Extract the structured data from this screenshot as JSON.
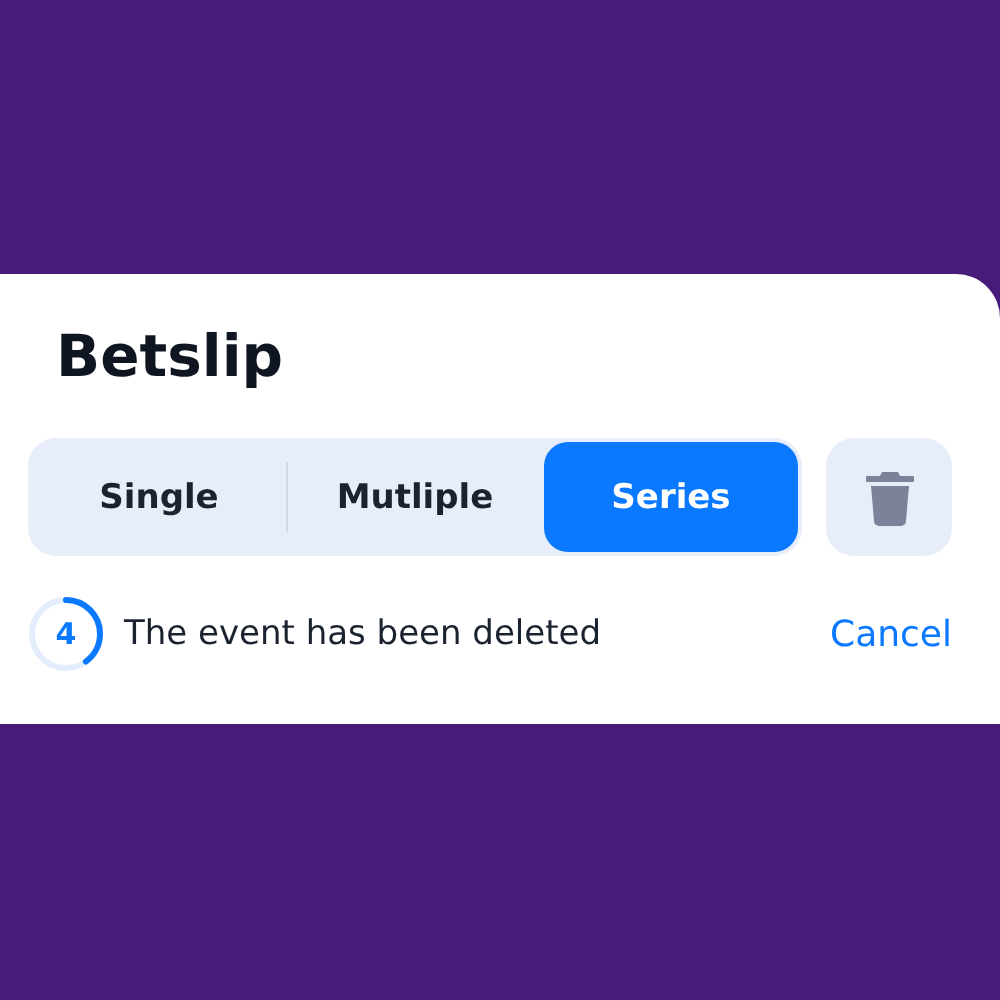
{
  "title": "Betslip",
  "tabs": [
    {
      "label": "Single",
      "selected": false
    },
    {
      "label": "Mutliple",
      "selected": false
    },
    {
      "label": "Series",
      "selected": true
    }
  ],
  "notice": {
    "countdown": "4",
    "level": 0.4,
    "message": "The event has been deleted",
    "action": "Cancel"
  }
}
